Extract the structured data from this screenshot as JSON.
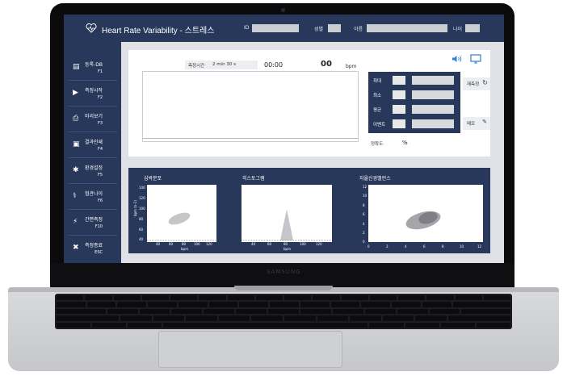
{
  "app": {
    "title": "Heart Rate Variability - 스트레스",
    "header": {
      "id_label": "ID",
      "gender_label": "성별",
      "name_label": "이름",
      "age_label": "나이"
    }
  },
  "sidebar": {
    "items": [
      {
        "label": "등록-DB",
        "key": "F1",
        "icon": "register-icon"
      },
      {
        "label": "측정시작",
        "key": "F2",
        "icon": "play-icon"
      },
      {
        "label": "미리보기",
        "key": "F3",
        "icon": "preview-icon"
      },
      {
        "label": "결과인쇄",
        "key": "F4",
        "icon": "printer-icon"
      },
      {
        "label": "환경설정",
        "key": "F5",
        "icon": "gear-icon"
      },
      {
        "label": "협관나이",
        "key": "F6",
        "icon": "vessel-icon"
      },
      {
        "label": "간편측정",
        "key": "F10",
        "icon": "lightning-icon"
      },
      {
        "label": "측정종료",
        "key": "ESC",
        "icon": "close-icon"
      }
    ]
  },
  "measure": {
    "time_label": "측정시간",
    "time_value": "2 min 30 s",
    "timer": "00:00",
    "bpm_value": "00",
    "bpm_unit": "bpm",
    "accuracy_label": "정확도",
    "accuracy_unit": "%"
  },
  "stats": {
    "labels": [
      "최대",
      "최소",
      "평균",
      "이벤트"
    ],
    "remeasure_label": "재측정",
    "memo_label": "메모"
  },
  "charts": [
    {
      "title": "심박분포",
      "xlabel": "bpm",
      "ylabel": "bpm (n-1)",
      "xticks": [
        "40",
        "60",
        "80",
        "100",
        "120"
      ],
      "yticks": [
        "140",
        "120",
        "100",
        "80",
        "60",
        "40"
      ]
    },
    {
      "title": "히스토그램",
      "xlabel": "bpm",
      "xticks": [
        "40",
        "60",
        "80",
        "100",
        "120"
      ]
    },
    {
      "title": "자율신경밸런스",
      "xticks": [
        "0",
        "2",
        "4",
        "6",
        "8",
        "10",
        "12"
      ],
      "yticks": [
        "12",
        "10",
        "8",
        "6",
        "4",
        "2",
        "0"
      ]
    }
  ],
  "laptop": {
    "brand": "SAMSUNG"
  },
  "colors": {
    "navy": "#27385a",
    "panel": "#dfe1e6",
    "accent": "#2f7fd0"
  }
}
